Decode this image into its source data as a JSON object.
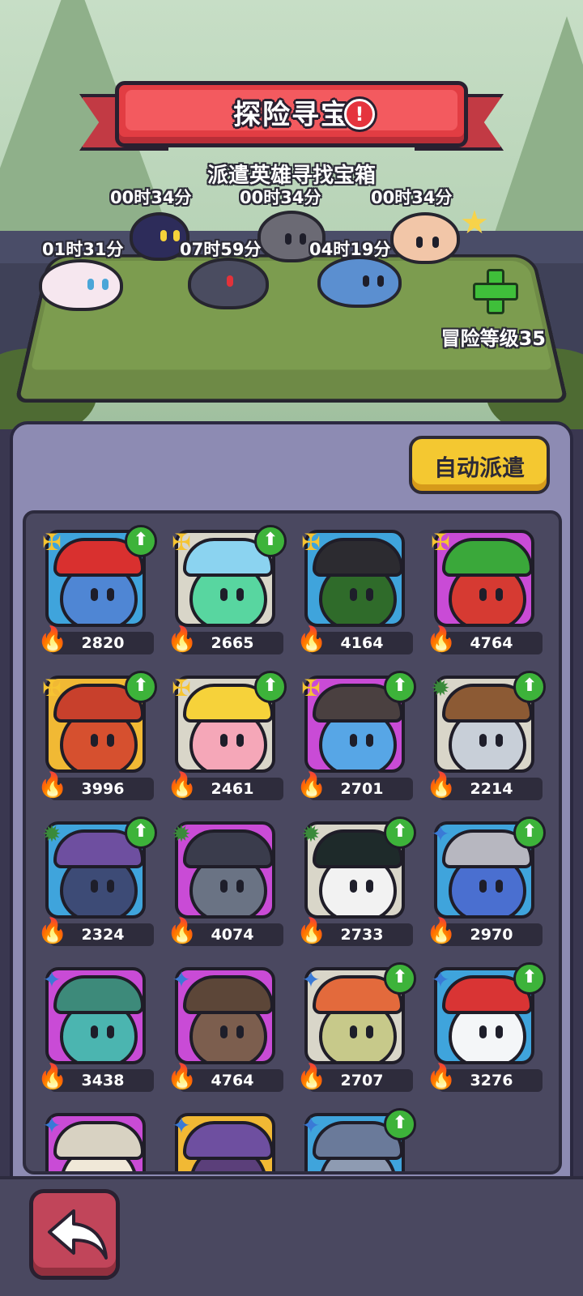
{
  "header": {
    "title": "探险寻宝",
    "alert_icon": "exclamation-icon",
    "subtitle": "派遣英雄寻找宝箱"
  },
  "expedition": {
    "timers": [
      "00时34分",
      "00时34分",
      "00时34分",
      "01时31分",
      "07时59分",
      "04时19分"
    ],
    "adventure_level": "冒险等级35",
    "add_icon": "plus-icon"
  },
  "auto_dispatch_label": "自动派遣",
  "heroes": [
    {
      "power": "2820",
      "rank": "gold",
      "upgrade": true
    },
    {
      "power": "2665",
      "rank": "gold",
      "upgrade": true
    },
    {
      "power": "4164",
      "rank": "gold",
      "upgrade": false
    },
    {
      "power": "4764",
      "rank": "gold",
      "upgrade": false
    },
    {
      "power": "3996",
      "rank": "gold",
      "upgrade": true
    },
    {
      "power": "2461",
      "rank": "gold",
      "upgrade": true
    },
    {
      "power": "2701",
      "rank": "gold",
      "upgrade": true
    },
    {
      "power": "2214",
      "rank": "green",
      "upgrade": true
    },
    {
      "power": "2324",
      "rank": "green",
      "upgrade": true
    },
    {
      "power": "4074",
      "rank": "green",
      "upgrade": false
    },
    {
      "power": "2733",
      "rank": "green",
      "upgrade": true
    },
    {
      "power": "2970",
      "rank": "blue",
      "upgrade": true
    },
    {
      "power": "3438",
      "rank": "blue",
      "upgrade": false
    },
    {
      "power": "4764",
      "rank": "blue",
      "upgrade": false
    },
    {
      "power": "2707",
      "rank": "blue",
      "upgrade": true
    },
    {
      "power": "3276",
      "rank": "blue",
      "upgrade": true
    },
    {
      "power": "",
      "rank": "blue",
      "upgrade": false
    },
    {
      "power": "",
      "rank": "blue",
      "upgrade": false
    },
    {
      "power": "",
      "rank": "blue",
      "upgrade": true
    }
  ],
  "colors": {
    "accent_red": "#e23d43",
    "button_yellow": "#f4c831",
    "panel": "#8d8bb3",
    "grid_bg": "#4a4860",
    "upgrade_green": "#3db33a"
  },
  "back_icon": "back-arrow-icon"
}
